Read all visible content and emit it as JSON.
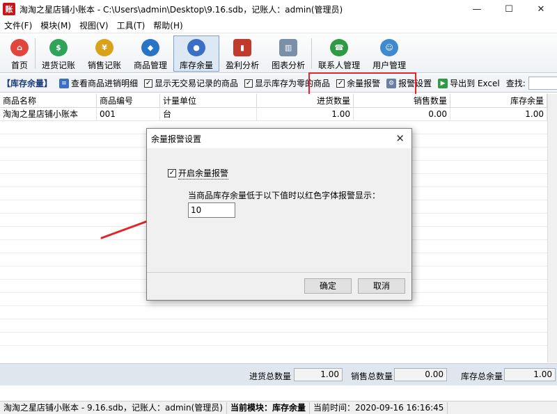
{
  "window": {
    "title": "淘淘之星店铺小账本 - C:\\Users\\admin\\Desktop\\9.16.sdb，记账人：admin(管理员)",
    "logo_text": "账",
    "min_glyph": "—",
    "max_glyph": "☐",
    "close_glyph": "✕"
  },
  "menu": [
    "文件(F)",
    "模块(M)",
    "视图(V)",
    "工具(T)",
    "帮助(H)"
  ],
  "toolbar": [
    {
      "label": "首页",
      "color": "#e0463c"
    },
    {
      "label": "进货记账",
      "color": "#2fa35a"
    },
    {
      "label": "销售记账",
      "color": "#d9a21a"
    },
    {
      "label": "商品管理",
      "color": "#2a74c5"
    },
    {
      "label": "库存余量",
      "color": "#3b6fc6"
    },
    {
      "label": "盈利分析",
      "color": "#c0392b"
    },
    {
      "label": "图表分析",
      "color": "#7a8fa8"
    },
    {
      "label": "联系人管理",
      "color": "#2e9a43"
    },
    {
      "label": "用户管理",
      "color": "#3d8ad0"
    }
  ],
  "subbar": {
    "title": "【库存余量】",
    "view_detail": "查看商品进销明细",
    "show_no_trade": "显示无交易记录的商品",
    "show_zero_stock": "显示库存为零的商品",
    "stock_alert": "余量报警",
    "alert_settings": "报警设置",
    "export": "导出到 Excel",
    "search_label": "查找:"
  },
  "table": {
    "headers": [
      "商品名称",
      "商品编号",
      "计量单位",
      "进货数量",
      "销售数量",
      "库存余量"
    ],
    "rows": [
      [
        "淘淘之星店铺小账本",
        "001",
        "台",
        "1.00",
        "0.00",
        "1.00"
      ]
    ]
  },
  "summary": {
    "purchase_label": "进货总数量",
    "purchase_value": "1.00",
    "sales_label": "销售总数量",
    "sales_value": "0.00",
    "stock_label": "库存总余量",
    "stock_value": "1.00"
  },
  "status": {
    "file": "淘淘之星店铺小账本 - 9.16.sdb，记账人：admin(管理员)",
    "module": "当前模块：库存余量",
    "time": "当前时间：2020-09-16 16:16:45"
  },
  "dialog": {
    "title": "余量报警设置",
    "enable_label": "开启余量报警",
    "description": "当商品库存余量低于以下值时以红色字体报警显示：",
    "threshold_value": "10",
    "ok_label": "确定",
    "cancel_label": "取消"
  },
  "colors": {
    "accent_red": "#e5232a",
    "active_tool_bg": "#dde8f5"
  }
}
